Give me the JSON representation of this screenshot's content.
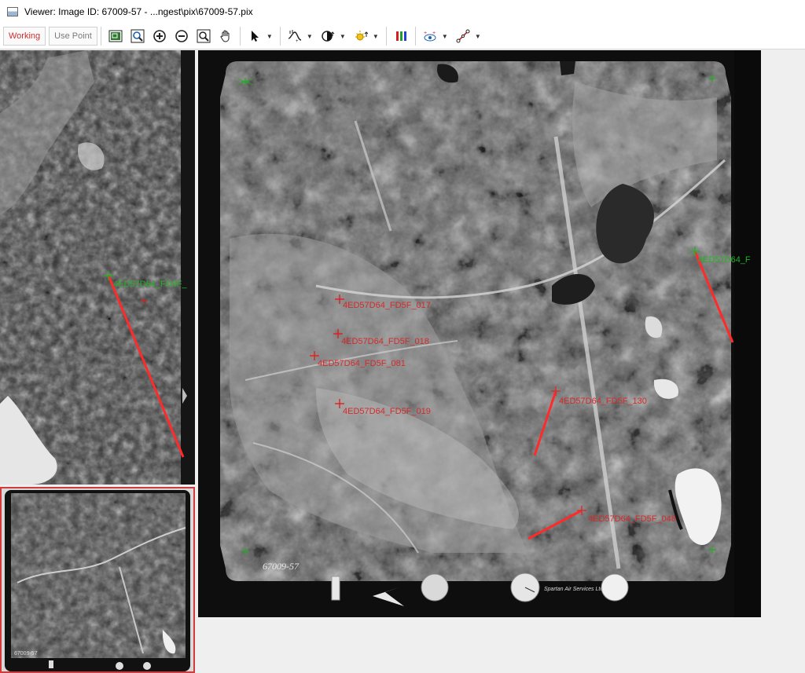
{
  "window": {
    "title": "Viewer: Image ID: 67009-57 - ...ngest\\pix\\67009-57.pix"
  },
  "toolbar": {
    "working_label": "Working",
    "use_point_label": "Use Point",
    "icons": [
      "overview-icon",
      "zoom-window-icon",
      "zoom-in-icon",
      "zoom-out-icon",
      "zoom-fit-icon",
      "pan-hand-icon",
      "pointer-icon",
      "histogram-icon",
      "contrast-icon",
      "brightness-icon",
      "rgb-bands-icon",
      "view-options-icon",
      "measure-icon"
    ],
    "colors": {
      "working": "#d42b2b",
      "accent_red": "#e02020",
      "gcp_green": "#1aa01a"
    }
  },
  "main_view": {
    "film_caption": "67009-57",
    "company_text": "Spartan Air Services Ltd",
    "gcps": [
      {
        "label": "4ED57D64_FD5F_017"
      },
      {
        "label": "4ED57D64_FD5F_018"
      },
      {
        "label": "4ED57D64_FD5F_081"
      },
      {
        "label": "4ED57D64_FD5F_019"
      },
      {
        "label": "4ED57D64_FD5F_130"
      },
      {
        "label": "4ED57D64_FD5F_048"
      },
      {
        "label": "4ED57D64_F"
      }
    ]
  },
  "left_top_view": {
    "gcp_label": "4ED57D64_FD5F_"
  },
  "left_bottom_view": {
    "caption": "67009-57"
  }
}
